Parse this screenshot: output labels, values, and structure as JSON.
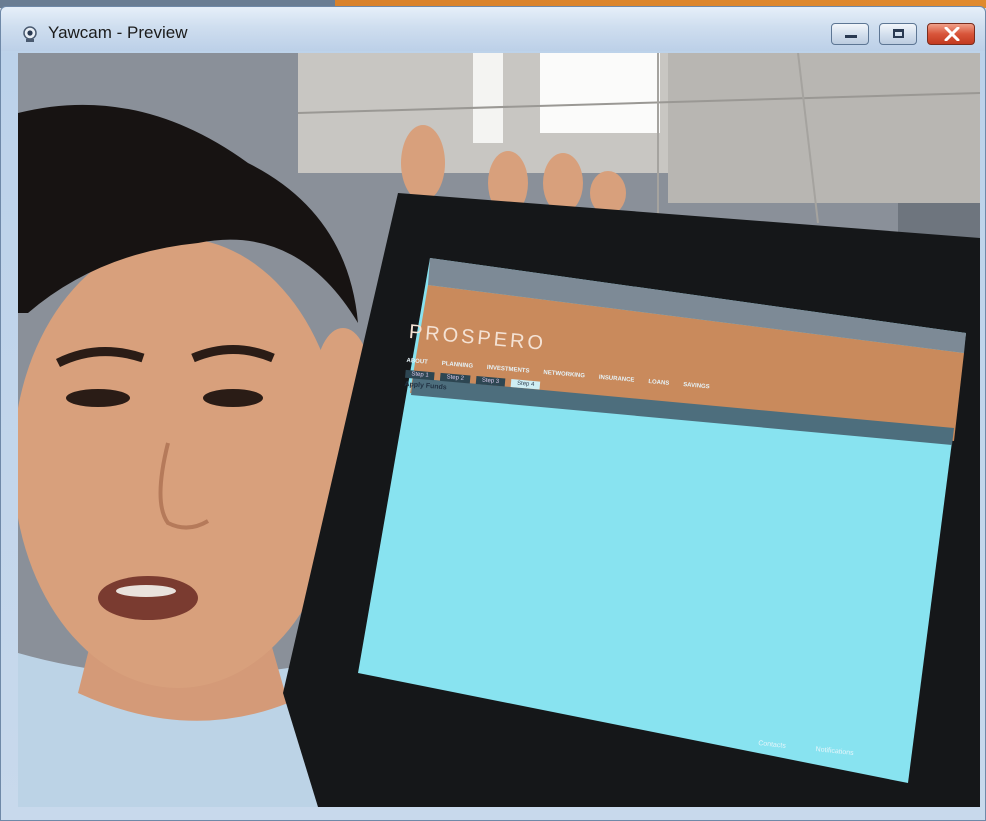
{
  "window": {
    "title": "Yawcam - Preview",
    "icon": "webcam-icon",
    "controls": [
      "minimize-icon",
      "maximize-icon",
      "close-icon"
    ]
  },
  "preview": {
    "tablet_screen": {
      "site_logo": "PROSPERO",
      "nav_items": [
        "ABOUT",
        "PLANNING",
        "INVESTMENTS",
        "NETWORKING",
        "INSURANCE",
        "LOANS",
        "SAVINGS"
      ],
      "tabs": [
        "Step 1",
        "Step 2",
        "Step 3",
        "Step 4"
      ],
      "section_heading": "Apply Funds",
      "bottom_bar": [
        "Contacts",
        "Notifications"
      ]
    }
  },
  "colors": {
    "titlebar": "#cfdeef",
    "site_header": "#c98a5c",
    "tablet_screen": "#8fe6f2",
    "close_button": "#d8553a"
  }
}
